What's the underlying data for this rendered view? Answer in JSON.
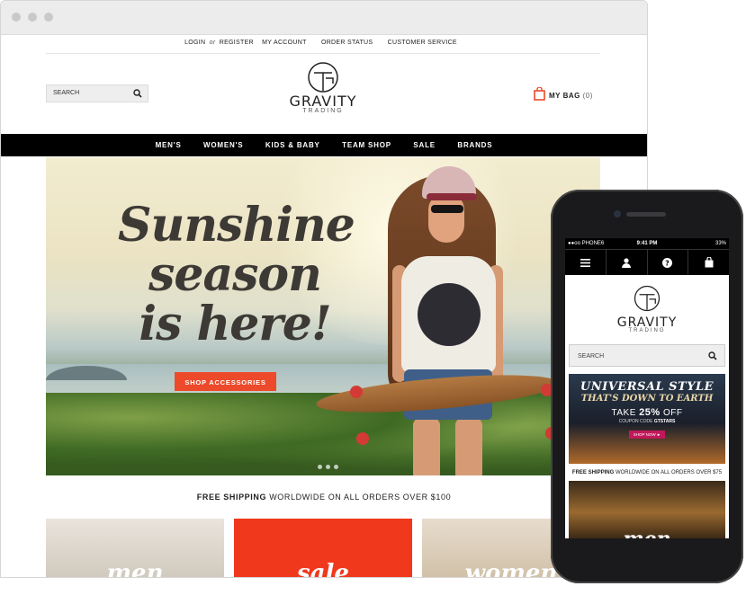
{
  "desktop": {
    "top_links": {
      "login": "LOGIN",
      "or": "or",
      "register": "REGISTER",
      "account": "MY ACCOUNT",
      "order_status": "ORDER STATUS",
      "customer_service": "CUSTOMER SERVICE"
    },
    "search_placeholder": "SEARCH",
    "logo": {
      "name": "GRAVITY",
      "sub": "TRADING",
      "mark": "GT"
    },
    "bag": {
      "label": "MY BAG",
      "count": "(0)"
    },
    "nav": [
      "MEN'S",
      "WOMEN'S",
      "KIDS & BABY",
      "TEAM SHOP",
      "SALE",
      "BRANDS"
    ],
    "hero": {
      "headline_1": "Sunshine",
      "headline_2": "season",
      "headline_3": "is here!",
      "button": "SHOP ACCESSORIES"
    },
    "free_shipping": {
      "bold": "FREE SHIPPING",
      "rest": "WORLDWIDE ON ALL ORDERS OVER $100"
    },
    "tiles": [
      "men",
      "sale",
      "women"
    ]
  },
  "mobile": {
    "status": {
      "carrier": "●●oo PHONE6",
      "time": "9:41 PM",
      "battery": "33%"
    },
    "search_placeholder": "SEARCH",
    "logo": {
      "name": "GRAVITY",
      "sub": "TRADING"
    },
    "promo": {
      "line1": "UNIVERSAL STYLE",
      "line2": "THAT'S DOWN TO EARTH",
      "take": "TAKE",
      "pct": "25%",
      "off": "OFF",
      "code_label": "COUPON CODE",
      "code": "GTSTARS",
      "button": "SHOP NOW ►"
    },
    "free_shipping": {
      "bold": "FREE SHIPPING",
      "rest": "WORLDWIDE ON ALL ORDERS OVER $75"
    },
    "tile": "men"
  },
  "colors": {
    "accent": "#ec4a2b",
    "nav_bg": "#000000",
    "sale_tile": "#f0381d"
  }
}
